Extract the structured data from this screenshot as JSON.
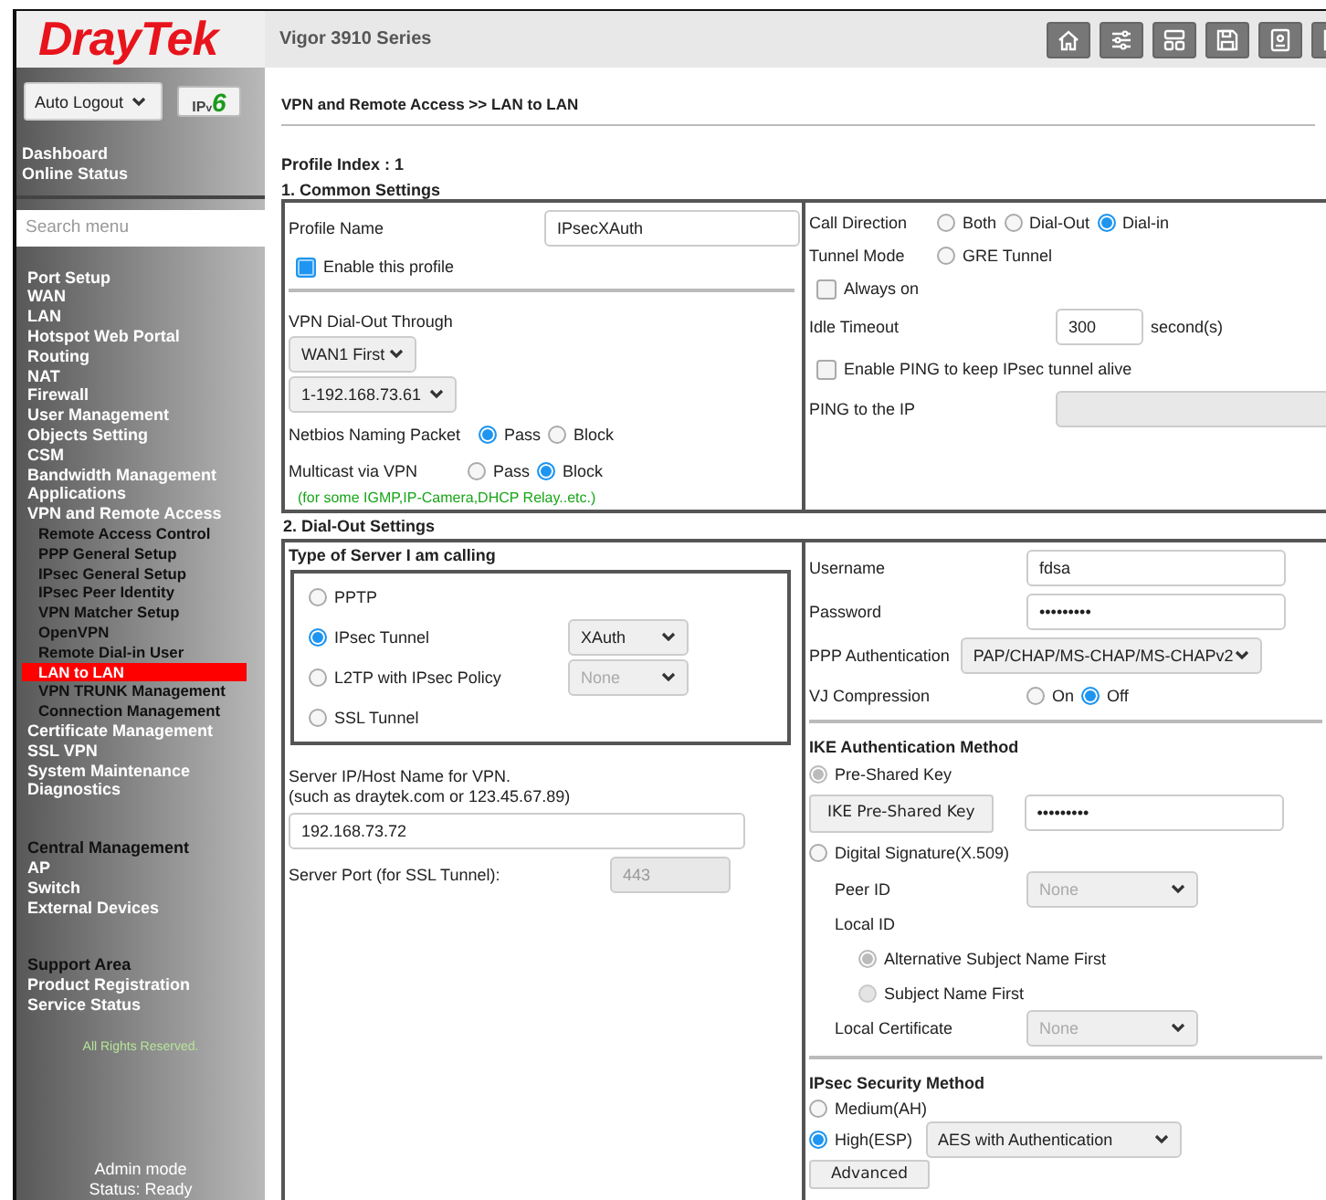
{
  "sidebar": {
    "logo": "DrayTek",
    "auto_logout": "Auto Logout",
    "ipv6": [
      "IP",
      "v",
      "6"
    ],
    "quick_links": [
      "Dashboard",
      "Online Status"
    ],
    "search": {
      "placeholder": "Search menu"
    },
    "menu_groups": [
      {
        "items": [
          {
            "label": "Port Setup",
            "kind": "item",
            "selected": false
          },
          {
            "label": "WAN",
            "kind": "item",
            "selected": false
          },
          {
            "label": "LAN",
            "kind": "item",
            "selected": false
          },
          {
            "label": "Hotspot Web Portal",
            "kind": "item",
            "selected": false
          },
          {
            "label": "Routing",
            "kind": "item",
            "selected": false
          },
          {
            "label": "NAT",
            "kind": "item",
            "selected": false
          },
          {
            "label": "Firewall",
            "kind": "item",
            "selected": false
          },
          {
            "label": "User Management",
            "kind": "item",
            "selected": false
          },
          {
            "label": "Objects Setting",
            "kind": "item",
            "selected": false
          },
          {
            "label": "CSM",
            "kind": "item",
            "selected": false
          },
          {
            "label": "Bandwidth Management",
            "kind": "item",
            "selected": false
          },
          {
            "label": "Applications",
            "kind": "item",
            "selected": false
          },
          {
            "label": "VPN and Remote Access",
            "kind": "item",
            "selected": false,
            "children": [
              {
                "label": "Remote Access Control",
                "selected": false
              },
              {
                "label": "PPP General Setup",
                "selected": false
              },
              {
                "label": "IPsec General Setup",
                "selected": false
              },
              {
                "label": "IPsec Peer Identity",
                "selected": false
              },
              {
                "label": "VPN Matcher Setup",
                "selected": false
              },
              {
                "label": "OpenVPN",
                "selected": false
              },
              {
                "label": "Remote Dial-in User",
                "selected": false
              },
              {
                "label": "LAN to LAN",
                "selected": true
              },
              {
                "label": "VPN TRUNK Management",
                "selected": false
              },
              {
                "label": "Connection Management",
                "selected": false
              }
            ]
          },
          {
            "label": "Certificate Management",
            "kind": "item",
            "selected": false
          },
          {
            "label": "SSL VPN",
            "kind": "item",
            "selected": false
          },
          {
            "label": "System Maintenance",
            "kind": "item",
            "selected": false
          },
          {
            "label": "Diagnostics",
            "kind": "item",
            "selected": false
          }
        ]
      },
      {
        "items": [
          {
            "label": "Central Management",
            "kind": "heading"
          },
          {
            "label": "AP",
            "kind": "item",
            "selected": false
          },
          {
            "label": "Switch",
            "kind": "item",
            "selected": false
          },
          {
            "label": "External Devices",
            "kind": "item",
            "selected": false
          }
        ]
      },
      {
        "items": [
          {
            "label": "Support Area",
            "kind": "heading"
          },
          {
            "label": "Product Registration",
            "kind": "item",
            "selected": false
          },
          {
            "label": "Service Status",
            "kind": "item",
            "selected": false
          }
        ]
      }
    ],
    "rights": "All Rights Reserved.",
    "status": [
      "Admin mode",
      "Status: Ready"
    ]
  },
  "topbar": {
    "title": "Vigor 3910 Series"
  },
  "breadcrumb": "VPN and Remote Access >> LAN to LAN",
  "profile_index": "Profile Index : 1",
  "common_settings": {
    "heading": "1. Common Settings",
    "profile_name": {
      "label": "Profile Name",
      "value": "IPsecXAuth"
    },
    "enable": {
      "label": "Enable this profile",
      "checked": true
    },
    "dial_out_through": {
      "label": "VPN Dial-Out Through",
      "wan": {
        "value": "WAN1 First"
      },
      "ip": {
        "value": "1-192.168.73.61"
      }
    },
    "netbios": {
      "label": "Netbios Naming Packet",
      "options": [
        {
          "label": "Pass",
          "selected": true
        },
        {
          "label": "Block",
          "selected": false
        }
      ]
    },
    "multicast": {
      "label": "Multicast via VPN",
      "options": [
        {
          "label": "Pass",
          "selected": false
        },
        {
          "label": "Block",
          "selected": true
        }
      ]
    },
    "multicast_note": "(for some IGMP,IP-Camera,DHCP Relay..etc.)",
    "call_direction": {
      "label": "Call Direction",
      "options": [
        {
          "label": "Both",
          "selected": false
        },
        {
          "label": "Dial-Out",
          "selected": false
        },
        {
          "label": "Dial-in",
          "selected": true
        }
      ]
    },
    "tunnel_mode": {
      "label": "Tunnel Mode",
      "options": [
        {
          "label": "GRE Tunnel",
          "selected": false
        }
      ]
    },
    "always_on": {
      "label": "Always on",
      "checked": false
    },
    "idle_timeout": {
      "label": "Idle Timeout",
      "value": "300",
      "unit": "second(s)"
    },
    "ping_keepalive": {
      "label": "Enable PING to keep IPsec tunnel alive",
      "checked": false
    },
    "ping_ip": {
      "label": "PING to the IP",
      "disabled": true
    }
  },
  "dial_out_settings": {
    "heading": "2. Dial-Out Settings",
    "server_type": {
      "label": "Type of Server I am calling",
      "options": [
        {
          "label": "PPTP",
          "selected": false
        },
        {
          "label": "IPsec Tunnel",
          "selected": true,
          "select": {
            "value": "XAuth",
            "disabled": false
          }
        },
        {
          "label": "L2TP with IPsec Policy",
          "selected": false,
          "select": {
            "value": "None",
            "disabled": true
          }
        },
        {
          "label": "SSL Tunnel",
          "selected": false
        }
      ]
    },
    "server_host": {
      "label": [
        "Server IP/Host Name for VPN.",
        "(such as draytek.com or 123.45.67.89)"
      ],
      "value": "192.168.73.72"
    },
    "server_port": {
      "label": "Server Port (for SSL Tunnel):",
      "value": "443",
      "disabled": true
    },
    "username": {
      "label": "Username",
      "value": "fdsa"
    },
    "password": {
      "label": "Password",
      "value": "•••••••••"
    },
    "ppp_auth": {
      "label": "PPP Authentication",
      "value": "PAP/CHAP/MS-CHAP/MS-CHAPv2"
    },
    "vj_compression": {
      "label": "VJ Compression",
      "options": [
        {
          "label": "On",
          "selected": false
        },
        {
          "label": "Off",
          "selected": true
        }
      ]
    },
    "ike": {
      "heading": "IKE Authentication Method",
      "pre_shared": {
        "label": "Pre-Shared Key",
        "selected": true,
        "disabled": true
      },
      "key_button": "IKE Pre-Shared Key",
      "key_value": "•••••••••",
      "digital_signature": {
        "label": "Digital Signature(X.509)",
        "selected": false
      },
      "peer_id": {
        "label": "Peer ID",
        "value": "None",
        "disabled": true
      },
      "local_id": {
        "label": "Local ID",
        "options": [
          {
            "label": "Alternative Subject Name First",
            "selected": true,
            "disabled": true
          },
          {
            "label": "Subject Name First",
            "selected": false,
            "disabled": true
          }
        ]
      },
      "local_certificate": {
        "label": "Local Certificate",
        "value": "None",
        "disabled": true
      }
    },
    "ipsec_security": {
      "heading": "IPsec Security Method",
      "options": [
        {
          "label": "Medium(AH)",
          "selected": false
        },
        {
          "label": "High(ESP)",
          "selected": true,
          "select": {
            "value": "AES with Authentication",
            "disabled": false
          }
        }
      ],
      "advanced": "Advanced"
    }
  }
}
